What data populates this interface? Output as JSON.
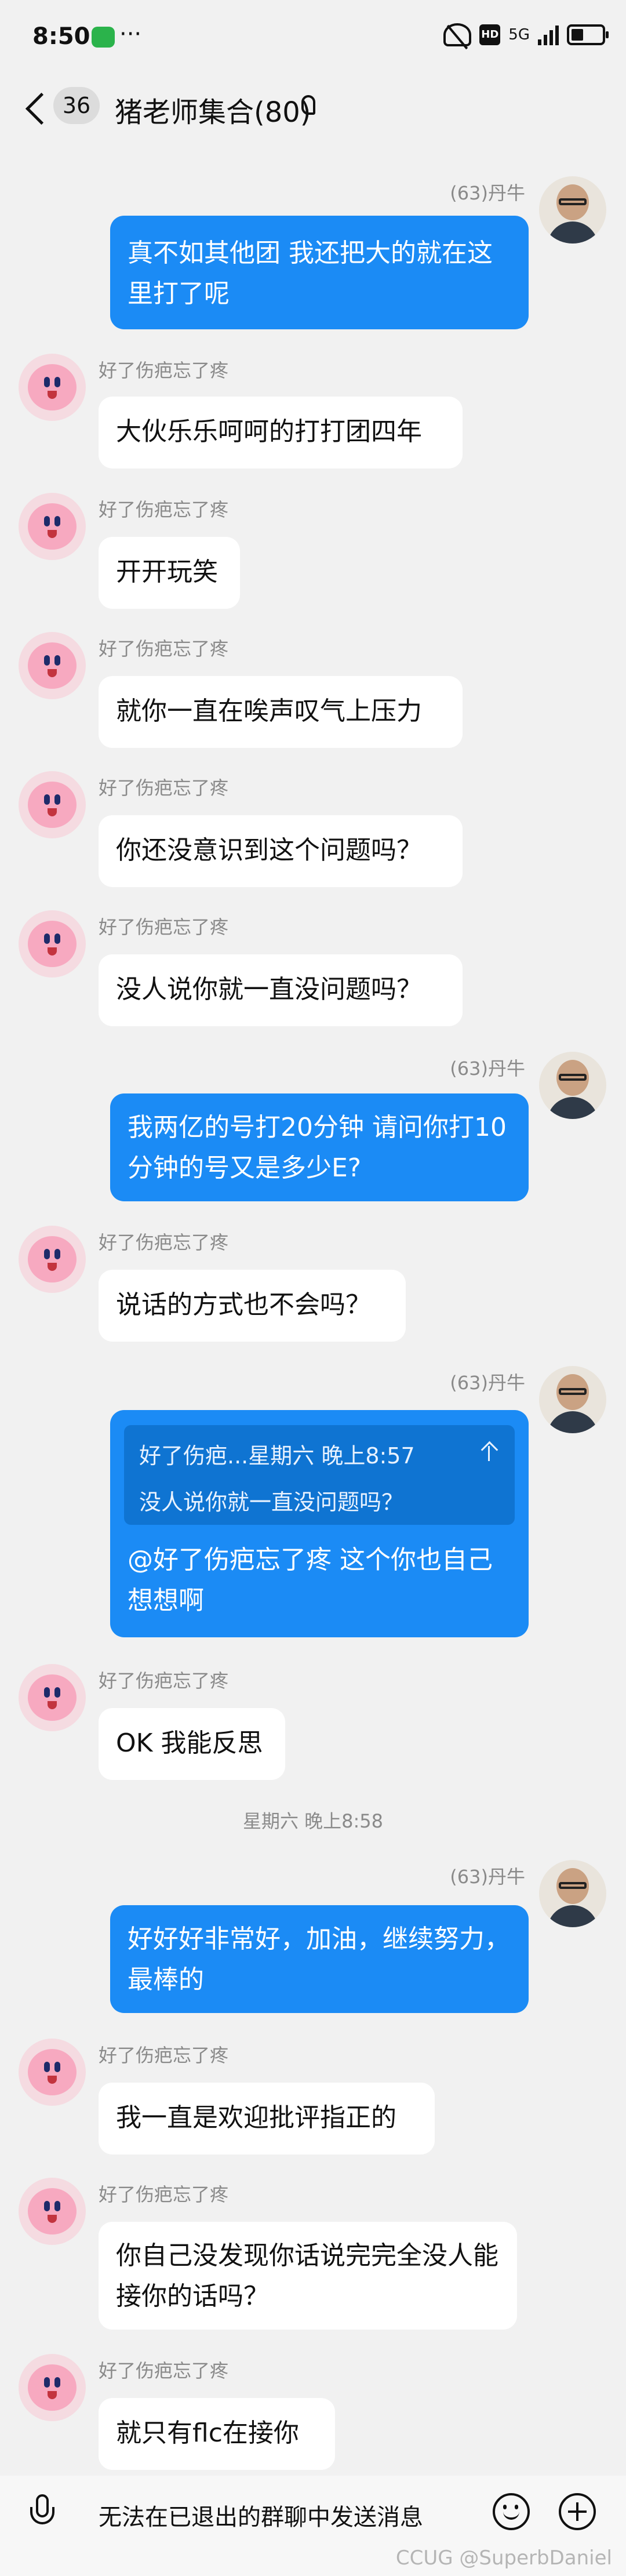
{
  "status_bar": {
    "time": "8:50",
    "more": "···",
    "signal_label": "5G"
  },
  "header": {
    "unread_count": "36",
    "title": "猪老师集合(80)"
  },
  "messages": [
    {
      "sender": "(63)丹牛",
      "text": "真不如其他团 我还把大的就在这里打了呢"
    },
    {
      "sender": "好了伤疤忘了疼",
      "text": "大伙乐乐呵呵的打打团四年"
    },
    {
      "sender": "好了伤疤忘了疼",
      "text": "开开玩笑"
    },
    {
      "sender": "好了伤疤忘了疼",
      "text": "就你一直在唉声叹气上压力"
    },
    {
      "sender": "好了伤疤忘了疼",
      "text": "你还没意识到这个问题吗？"
    },
    {
      "sender": "好了伤疤忘了疼",
      "text": "没人说你就一直没问题吗？"
    },
    {
      "sender": "(63)丹牛",
      "text": "我两亿的号打20分钟 请问你打10分钟的号又是多少E?"
    },
    {
      "sender": "好了伤疤忘了疼",
      "text": "说话的方式也不会吗？"
    },
    {
      "sender": "(63)丹牛",
      "quote_head": "好了伤疤...星期六 晚上8:57",
      "quote_text": "没人说你就一直没问题吗？",
      "text": "@好了伤疤忘了疼  这个你也自己想想啊"
    },
    {
      "sender": "好了伤疤忘了疼",
      "text": "OK 我能反思"
    },
    {
      "sender": "(63)丹牛",
      "text": "好好好非常好，加油，继续努力，最棒的"
    },
    {
      "sender": "好了伤疤忘了疼",
      "text": "我一直是欢迎批评指正的"
    },
    {
      "sender": "好了伤疤忘了疼",
      "text": "你自己没发现你话说完完全没人能接你的话吗？"
    },
    {
      "sender": "好了伤疤忘了疼",
      "text": "就只有flc在接你"
    }
  ],
  "time_divider": "星期六 晚上8:58",
  "input": {
    "placeholder": "无法在已退出的群聊中发送消息"
  },
  "watermark": "CCUG @SuperbDaniel",
  "colors": {
    "outgoing_bubble": "#1b8bf5",
    "incoming_bubble": "#ffffff",
    "background": "#f1f1f1"
  }
}
